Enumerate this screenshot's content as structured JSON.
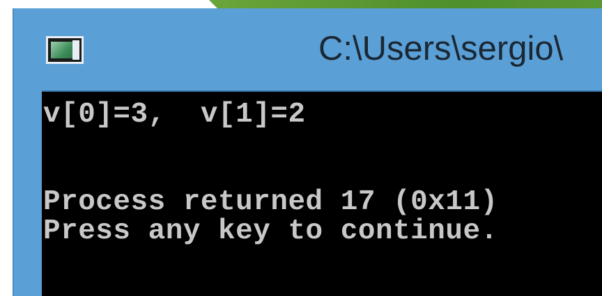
{
  "window": {
    "title": "C:\\Users\\sergio\\"
  },
  "console": {
    "lines": [
      "v[0]=3,  v[1]=2",
      "",
      "Process returned 17 (0x11)",
      "Press any key to continue."
    ]
  },
  "colors": {
    "titlebar": "#5aa0d6",
    "console_background": "#000000",
    "console_text": "#c8c8c8"
  }
}
